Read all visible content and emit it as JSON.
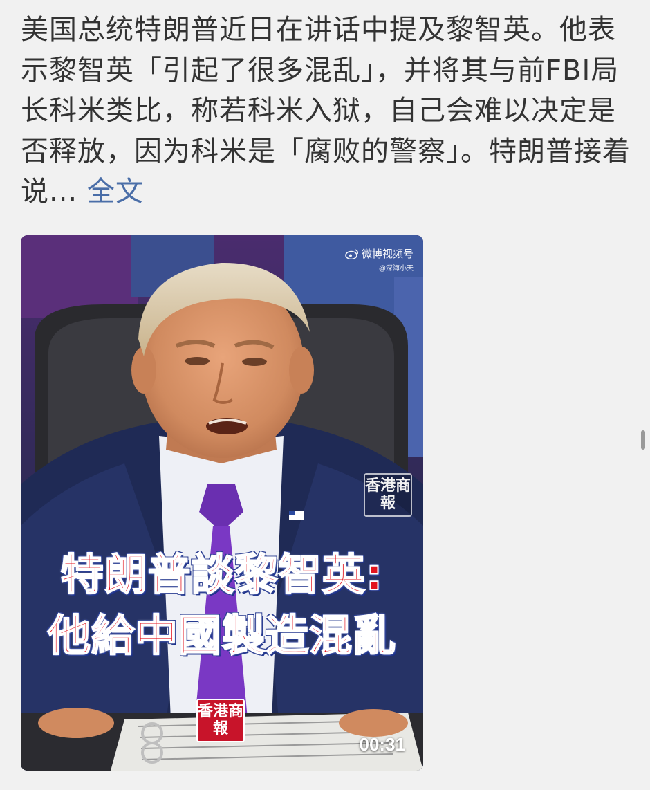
{
  "post": {
    "body_text": "美国总统特朗普近日在讲话中提及黎智英。他表示黎智英「引起了很多混乱」，并将其与前FBI局长科米类比，称若科米入狱，自己会难以决定是否释放，因为科米是「腐败的警察」。特朗普接着说...",
    "more_link": "全文"
  },
  "video": {
    "watermark_brand": "微博视频号",
    "watermark_account": "@深海小天",
    "logo_text": "香港商報",
    "headline_line1": "特朗普談黎智英:",
    "headline_line2": "他給中國製造混亂",
    "duration": "00:31"
  },
  "icons": {
    "weibo_logo": "weibo-logo-icon"
  },
  "colors": {
    "link": "#4a6ea8",
    "text": "#333333",
    "background": "#f1f1f1",
    "headline_red": "#e2141f",
    "logo_red": "#c8142a"
  }
}
